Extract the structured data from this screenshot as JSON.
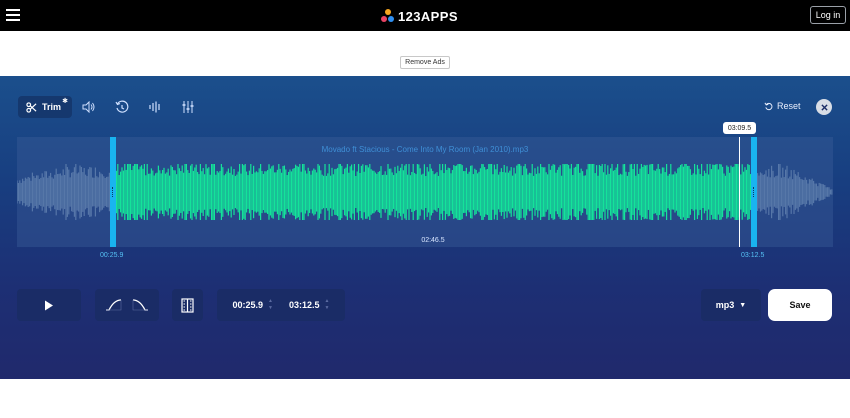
{
  "header": {
    "logo_text": "123APPS",
    "login_label": "Log in",
    "logo_colors": [
      "#f6a51f",
      "#e94364",
      "#2f8ff0"
    ]
  },
  "ads": {
    "remove_label": "Remove Ads"
  },
  "toolbar": {
    "tools": [
      {
        "icon": "scissors-icon",
        "label": "Trim",
        "active": true
      },
      {
        "icon": "volume-icon"
      },
      {
        "icon": "speed-icon"
      },
      {
        "icon": "equalizer-icon"
      },
      {
        "icon": "sliders-icon"
      }
    ],
    "reset_label": "Reset"
  },
  "editor": {
    "file_name": "Movado ft Stacious - Come Into My Room (Jan 2010).mp3",
    "playhead_time": "03:09.5",
    "selection_duration": "02:46.5",
    "start_time": "00:25.9",
    "end_time": "03:12.5",
    "waveform_color": "#14e39a"
  },
  "controls": {
    "play_icon": "play-icon",
    "fade_in_icon": "fade-in-icon",
    "fade_out_icon": "fade-out-icon",
    "split_icon": "split-icon",
    "start_value": "00:25.9",
    "end_value": "03:12.5",
    "format": "mp3",
    "save_label": "Save"
  }
}
